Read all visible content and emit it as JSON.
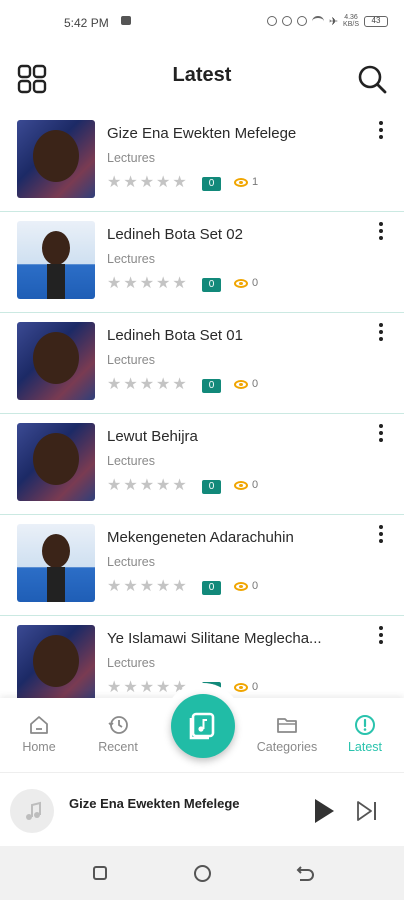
{
  "status_bar": {
    "time": "5:42 PM",
    "network": "4.36\nKB/S",
    "battery": "43"
  },
  "header": {
    "title": "Latest"
  },
  "items": [
    {
      "title": "Gize Ena Ewekten Mefelege",
      "category": "Lectures",
      "badge": "0",
      "views": "1",
      "thumb": "a"
    },
    {
      "title": "Ledineh Bota Set 02",
      "category": "Lectures",
      "badge": "0",
      "views": "0",
      "thumb": "b"
    },
    {
      "title": "Ledineh Bota Set 01",
      "category": "Lectures",
      "badge": "0",
      "views": "0",
      "thumb": "a"
    },
    {
      "title": "Lewut Behijra",
      "category": "Lectures",
      "badge": "0",
      "views": "0",
      "thumb": "a"
    },
    {
      "title": "Mekengeneten Adarachuhin",
      "category": "Lectures",
      "badge": "0",
      "views": "0",
      "thumb": "b"
    },
    {
      "title": "Ye Islamawi Silitane Meglecha...",
      "category": "Lectures",
      "badge": "0",
      "views": "0",
      "thumb": "a"
    }
  ],
  "nav": {
    "home": "Home",
    "recent": "Recent",
    "categories": "Categories",
    "latest": "Latest"
  },
  "player": {
    "title": "Gize Ena Ewekten Mefelege"
  },
  "colors": {
    "accent": "#21bca6",
    "badge": "#12897a",
    "views_icon": "#f0a500",
    "divider": "#cbe9e2"
  }
}
